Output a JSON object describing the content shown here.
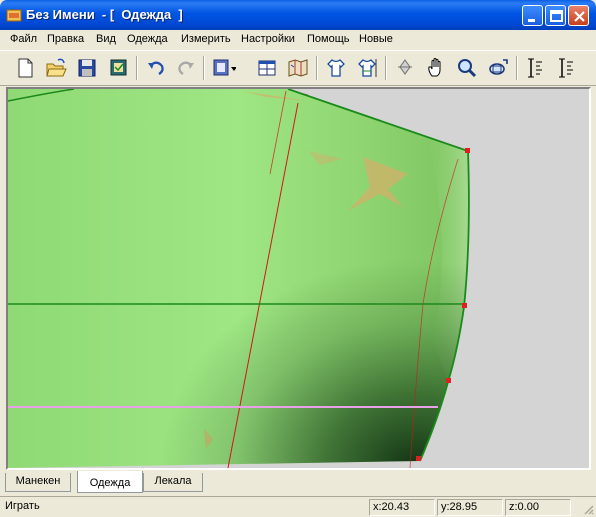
{
  "window": {
    "title": "Без Имени  - [  Одежда  ]"
  },
  "menu": [
    {
      "label": "Файл"
    },
    {
      "label": "Правка"
    },
    {
      "label": "Вид"
    },
    {
      "label": "Одежда"
    },
    {
      "label": "Измерить"
    },
    {
      "label": "Настройки"
    },
    {
      "label": "Помощь"
    },
    {
      "label": "Новые"
    }
  ],
  "toolbar": [
    "new-file-icon",
    "open-folder-icon",
    "save-icon",
    "save-all-icon",
    "undo-icon",
    "redo-icon",
    "mannequin-dropdown-icon",
    "window-icon",
    "map-icon",
    "shirt-icon",
    "shirt-measure-icon",
    "rotate-icon",
    "hand-pan-icon",
    "zoom-icon",
    "reset-view-icon",
    "measure-vertical-icon",
    "measure-vertical-2-icon"
  ],
  "tabs": [
    {
      "label": "Манекен"
    },
    {
      "label": "Одежда"
    },
    {
      "label": "Лекала"
    }
  ],
  "status": {
    "action": "Играть",
    "x": "x:20.43",
    "y": "y:28.95",
    "z": "z:0.00"
  },
  "colors": {
    "garment": "#9de37f",
    "outline": "#1a8a1a",
    "guide_red": "#d01818",
    "guide_pink": "#e8a0e8",
    "viewport_bg": "#d4d4d4"
  }
}
